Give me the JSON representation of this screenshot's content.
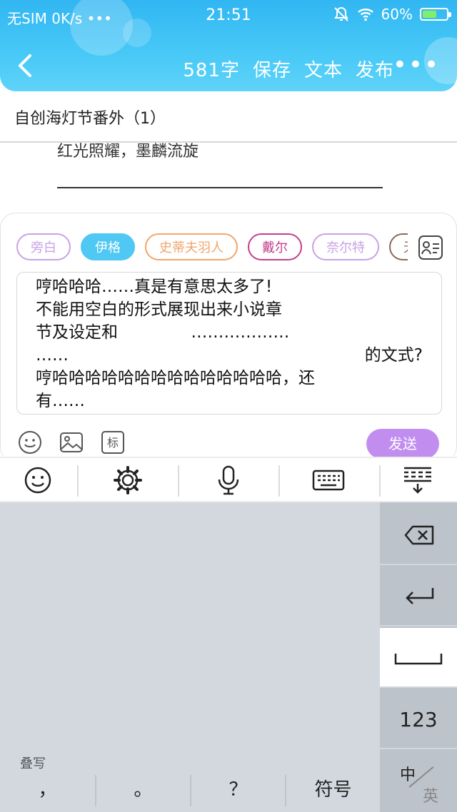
{
  "status_bar": {
    "carrier": "无SIM",
    "speed": "0K/s",
    "dots": "•••",
    "time": "21:51",
    "battery_pct": "60%",
    "battery_level": 0.6
  },
  "appbar": {
    "word_count": "581字",
    "save_label": "保存",
    "text_label": "文本",
    "publish_label": "发布",
    "more_label": "•••"
  },
  "document": {
    "title": "自创海灯节番外（1）",
    "preview_line": "红光照耀，墨麟流旋"
  },
  "compose": {
    "chips": [
      {
        "label": "旁白",
        "color": "#c8a2e6"
      },
      {
        "label": "伊格",
        "color": "#4fc8f3"
      },
      {
        "label": "史蒂夫羽人",
        "color": "#f1a66c"
      },
      {
        "label": "戴尔",
        "color": "#c23f8e"
      },
      {
        "label": "奈尔特",
        "color": "#c8a2e6"
      },
      {
        "label": "无",
        "color": "#8a6a55"
      }
    ],
    "editor_lines": [
      "哼哈哈哈……真是有意思太多了!",
      "不能用空白的形式展现出来小说章",
      "节及设定和              ………………",
      "……",
      "的文式?",
      "哼哈哈哈哈哈哈哈哈哈哈哈哈哈哈，还",
      "有……"
    ],
    "send_label": "发送"
  },
  "keyboard": {
    "stack_label": "叠写",
    "keys": {
      "comma": "，",
      "period": "。",
      "question": "？",
      "symbol": "符号",
      "numbers": "123",
      "lang_zh": "中",
      "lang_en": "英"
    }
  },
  "colors": {
    "header_gradient_top": "#31b6f2",
    "header_gradient_bottom": "#5fd3f9",
    "send_button": "#c18ef0",
    "keyboard_bg": "#d3d8df",
    "keyboard_side": "#bdc3cb"
  }
}
